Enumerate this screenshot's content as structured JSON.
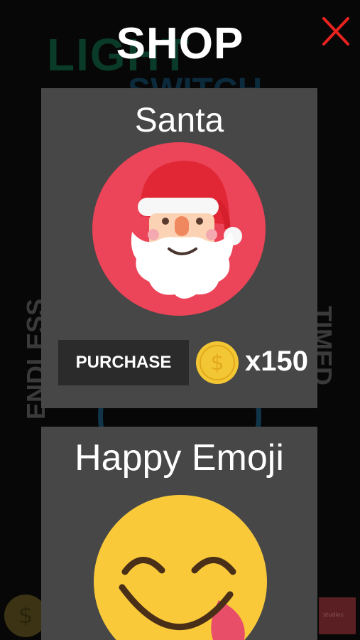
{
  "background": {
    "mode_left": "ENDLESS",
    "mode_right": "TIMED"
  },
  "shop": {
    "title": "SHOP",
    "close_label": "X"
  },
  "items": [
    {
      "name": "Santa",
      "icon": "santa-icon",
      "purchase_label": "PURCHASE",
      "price": "x150",
      "currency_icon": "coin-icon"
    },
    {
      "name": "Happy Emoji",
      "icon": "happy-emoji-icon"
    }
  ],
  "colors": {
    "card": "#474747",
    "button": "#2b2b2b",
    "santa_circle": "#ec4458",
    "coin": "#f3c634",
    "close": "#e8231f"
  }
}
